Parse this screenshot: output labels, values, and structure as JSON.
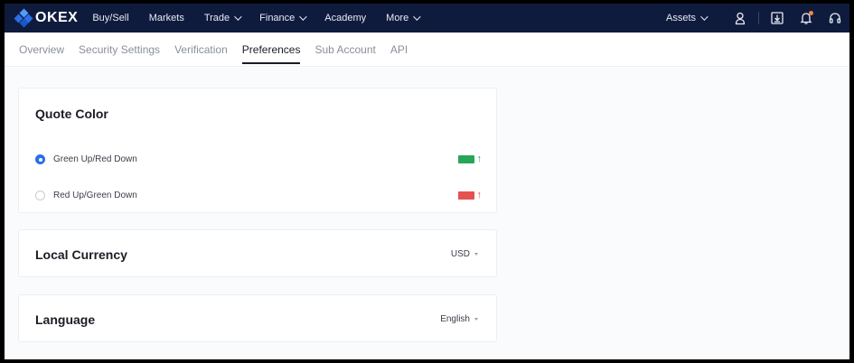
{
  "topbar": {
    "logo": "OKEX",
    "nav": [
      {
        "label": "Buy/Sell",
        "dropdown": false
      },
      {
        "label": "Markets",
        "dropdown": false
      },
      {
        "label": "Trade",
        "dropdown": true
      },
      {
        "label": "Finance",
        "dropdown": true
      },
      {
        "label": "Academy",
        "dropdown": false
      },
      {
        "label": "More",
        "dropdown": true
      }
    ],
    "assets_label": "Assets",
    "icons": [
      "user-icon",
      "download-icon",
      "bell-icon",
      "headset-icon"
    ]
  },
  "subnav": {
    "tabs": [
      {
        "label": "Overview",
        "active": false
      },
      {
        "label": "Security Settings",
        "active": false
      },
      {
        "label": "Verification",
        "active": false
      },
      {
        "label": "Preferences",
        "active": true
      },
      {
        "label": "Sub Account",
        "active": false
      },
      {
        "label": "API",
        "active": false
      }
    ]
  },
  "quote_color": {
    "title": "Quote Color",
    "options": [
      {
        "label": "Green Up/Red Down",
        "checked": true,
        "color": "#27a65a",
        "arrow": "↑"
      },
      {
        "label": "Red Up/Green Down",
        "checked": false,
        "color": "#e5514f",
        "arrow": "↑"
      }
    ]
  },
  "local_currency": {
    "title": "Local Currency",
    "value": "USD"
  },
  "language": {
    "title": "Language",
    "value": "English"
  },
  "colors": {
    "nav_bg": "#0f1b3d",
    "accent": "#2a6ee8",
    "up_green": "#27a65a",
    "up_red": "#e5514f"
  }
}
